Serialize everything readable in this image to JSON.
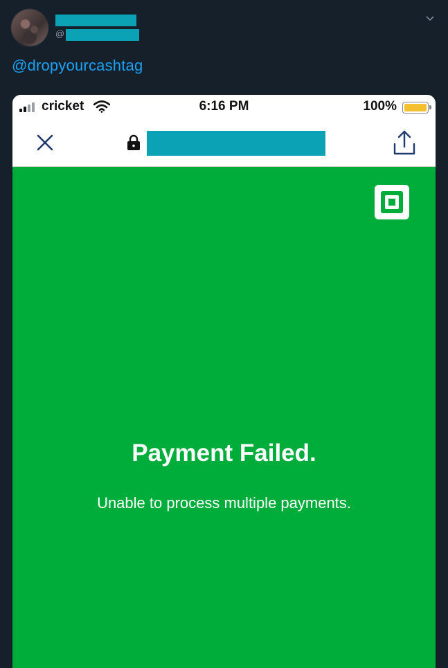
{
  "tweet": {
    "handle_at": "@",
    "text": "@dropyourcashtag"
  },
  "phone": {
    "status_bar": {
      "carrier": "cricket",
      "time": "6:16 PM",
      "battery_percent": "100%",
      "battery_level": 1.0
    }
  },
  "payment": {
    "title": "Payment Failed.",
    "message": "Unable to process multiple payments."
  },
  "colors": {
    "background": "#15202b",
    "link": "#1da1f2",
    "redaction": "#0aa2b4",
    "payment_green": "#00ad3b",
    "battery": "#f5c02e"
  },
  "icons": {
    "tweet_menu": "chevron-down-icon",
    "close": "close-icon",
    "lock": "lock-icon",
    "share": "share-icon",
    "brand": "square-logo-icon",
    "signal": "signal-icon",
    "wifi": "wifi-icon",
    "battery": "battery-icon"
  }
}
